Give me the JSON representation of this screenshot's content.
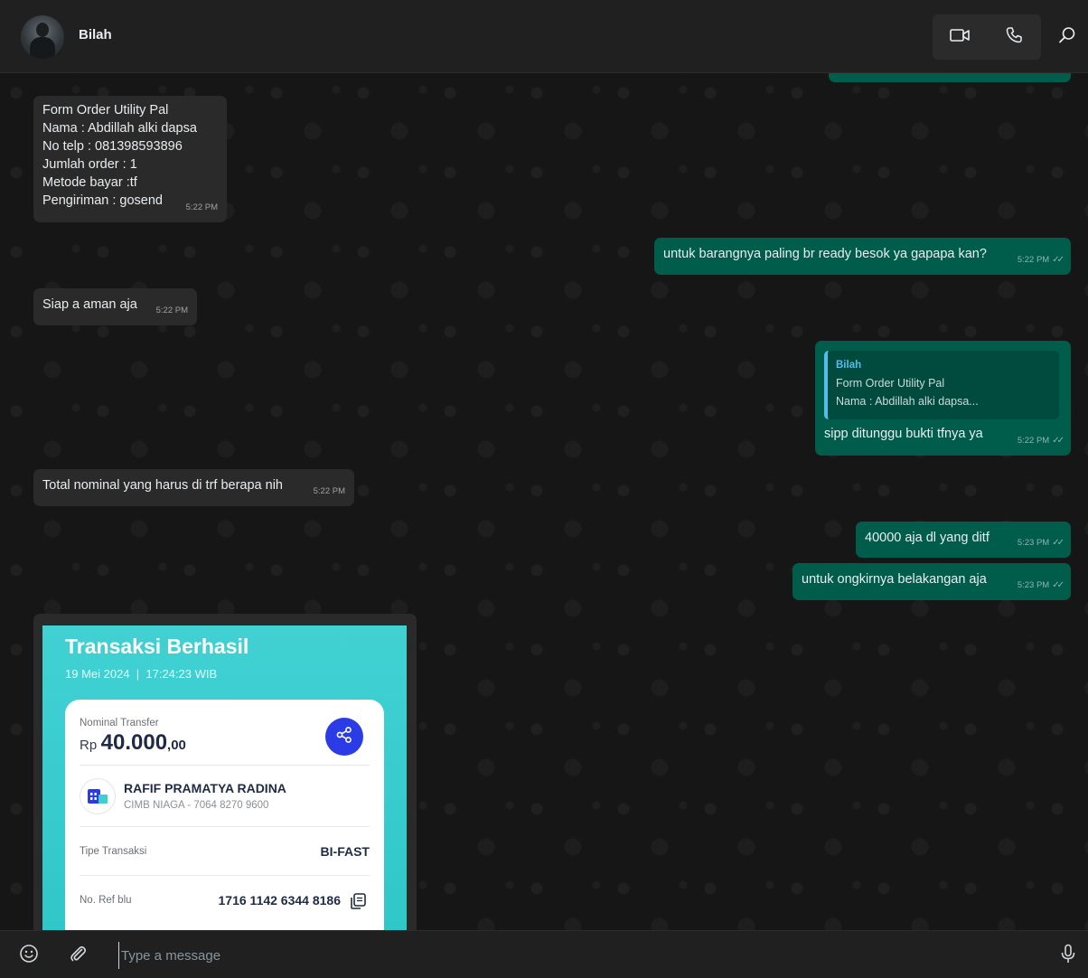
{
  "header": {
    "contact_name": "Bilah"
  },
  "messages": [
    {
      "dir": "in",
      "text": "Form Order Utility Pal\nNama : Abdillah alki dapsa\nNo telp : 081398593896\nJumlah order : 1\nMetode bayar :tf\nPengiriman : gosend",
      "time": "5:22 PM"
    },
    {
      "dir": "out",
      "text": "untuk barangnya paling br ready besok ya gapapa kan?",
      "time": "5:22 PM"
    },
    {
      "dir": "in",
      "text": "Siap a aman aja",
      "time": "5:22 PM"
    },
    {
      "dir": "out",
      "quote_author": "Bilah",
      "quote_line1": "Form Order Utility Pal",
      "quote_line2": "Nama : Abdillah alki dapsa...",
      "text": "sipp ditunggu bukti tfnya ya",
      "time": "5:22 PM"
    },
    {
      "dir": "in",
      "text": "Total nominal yang harus di trf berapa nih",
      "time": "5:22 PM"
    },
    {
      "dir": "out",
      "text": "40000 aja dl yang ditf",
      "time": "5:23 PM"
    },
    {
      "dir": "out",
      "text": "untuk ongkirnya belakangan aja",
      "time": "5:23 PM"
    }
  ],
  "receipt": {
    "title": "Transaksi Berhasil",
    "date": "19 Mei 2024  |  17:24:23 WIB",
    "nominal_label": "Nominal Transfer",
    "currency": "Rp",
    "amount": "40.000",
    "amount_decimal": ",00",
    "recipient_name": "RAFIF PRAMATYA RADINA",
    "recipient_bank": "CIMB NIAGA - 7064 8270 9600",
    "type_label": "Tipe Transaksi",
    "type_value": "BI-FAST",
    "ref_label": "No. Ref blu",
    "ref_value": "1716 1142 6344 8186"
  },
  "composer": {
    "placeholder": "Type a message"
  },
  "icons": {
    "video": "video-camera-icon",
    "voice": "phone-icon",
    "search": "search-icon",
    "emoji": "emoji-icon",
    "attach": "paperclip-icon",
    "mic": "microphone-icon",
    "scroll": "arrow-down-icon",
    "share": "share-icon",
    "copy": "copy-icon",
    "read_ticks": "double-check-icon"
  },
  "colors": {
    "incoming_bubble": "#2a2a2a",
    "outgoing_bubble": "#005c4b",
    "quote_accent": "#53bdeb",
    "receipt_teal": "#3ecfd1",
    "share_blue": "#2b3be6"
  }
}
